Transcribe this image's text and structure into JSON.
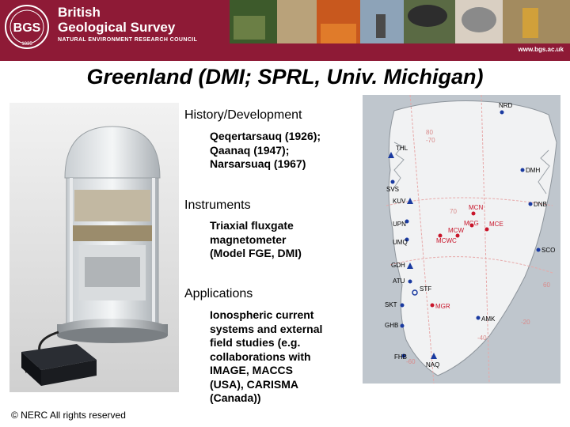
{
  "header": {
    "org_name_line1": "British",
    "org_name_line2": "Geological Survey",
    "org_subtitle": "NATURAL ENVIRONMENT RESEARCH COUNCIL",
    "logo_text": "BGS",
    "logo_year": "1835",
    "url": "www.bgs.ac.uk",
    "accent_color": "#8e1a36"
  },
  "title": "Greenland (DMI; SPRL, Univ. Michigan)",
  "sections": [
    {
      "heading": "History/Development",
      "lines": [
        "Qeqertarsauq (1926);",
        "Qaanaq (1947);",
        "Narsarsuaq (1967)"
      ]
    },
    {
      "heading": "Instruments",
      "lines": [
        "Triaxial fluxgate",
        "magnetometer",
        "(Model FGE, DMI)"
      ]
    },
    {
      "heading": "Applications",
      "lines": [
        "Ionospheric current",
        "systems and external",
        "field studies (e.g.",
        "collaborations with",
        "IMAGE, MACCS",
        "(USA), CARISMA",
        "(Canada))"
      ]
    }
  ],
  "copyright": "© NERC All rights reserved",
  "map": {
    "stations_west": [
      "THL",
      "SVS",
      "KUV",
      "UPN",
      "UMQ",
      "GDH",
      "ATU",
      "SKT",
      "GHB",
      "FHB",
      "NAQ",
      "STF"
    ],
    "stations_east": [
      "NRD",
      "DMH",
      "DNB",
      "SCO",
      "AMK"
    ],
    "stations_red": [
      "MCW",
      "MCG",
      "MCE",
      "MCN",
      "MCWC",
      "MGR"
    ],
    "graticule_labels": [
      "60",
      "70",
      "80",
      "-70",
      "-60",
      "-40",
      "-20"
    ]
  }
}
